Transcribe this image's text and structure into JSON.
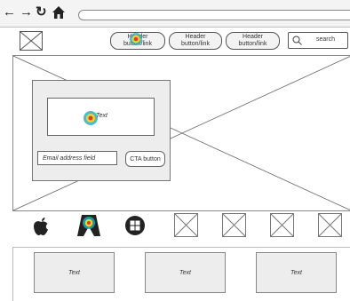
{
  "header": {
    "nav_buttons": [
      {
        "label": "Header button/link"
      },
      {
        "label": "Header button/link"
      },
      {
        "label": "Header button/link"
      }
    ],
    "search": {
      "label": "search"
    }
  },
  "hero": {
    "text_frame": "Text",
    "email_placeholder": "Email address field",
    "cta_label": "CTA button"
  },
  "logos": [
    "apple-icon",
    "badge-icon",
    "windows-icon",
    "placeholder",
    "placeholder",
    "placeholder",
    "placeholder"
  ],
  "features": [
    {
      "label": "Text"
    },
    {
      "label": "Text"
    },
    {
      "label": "Text"
    }
  ],
  "colors": {
    "wire_stroke": "#555555",
    "card_fill": "#ededed",
    "heat_outer": "#2aa7b3",
    "heat_mid": "#e9d43a",
    "heat_core": "#e23a2a"
  }
}
